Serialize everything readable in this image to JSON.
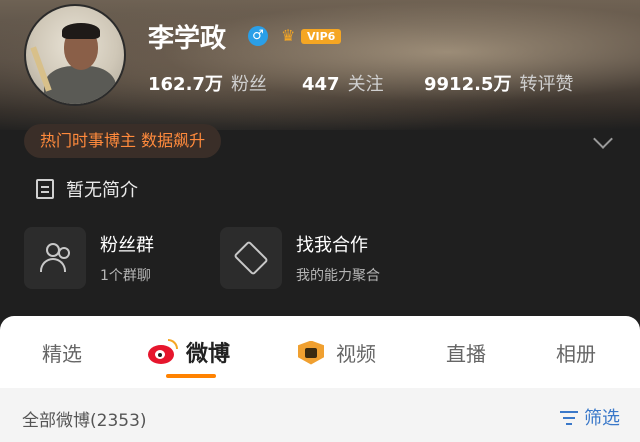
{
  "profile": {
    "name": "李学政",
    "gender_icon": "male-symbol-icon",
    "vip_label": "VIP6",
    "colors": {
      "gender": "#2a9fe8",
      "vip": "#f5a623",
      "hot_tag": "#ff8a3c",
      "accent": "#ff8200",
      "link": "#3a78c9"
    }
  },
  "stats": [
    {
      "num": "162.7万",
      "label": "粉丝"
    },
    {
      "num": "447",
      "label": "关注"
    },
    {
      "num": "9912.5万",
      "label": "转评赞"
    }
  ],
  "hot_tag": "热门时事博主 数据飙升",
  "bio": "暂无简介",
  "cards": [
    {
      "title": "粉丝群",
      "sub": "1个群聊",
      "icon": "people-icon"
    },
    {
      "title": "找我合作",
      "sub": "我的能力聚合",
      "icon": "handshake-icon"
    }
  ],
  "tabs": [
    {
      "label": "精选"
    },
    {
      "label": "微博",
      "active": true
    },
    {
      "label": "视频"
    },
    {
      "label": "直播"
    },
    {
      "label": "相册"
    }
  ],
  "list": {
    "count_label": "全部微博(2353)",
    "filter_label": "筛选"
  }
}
